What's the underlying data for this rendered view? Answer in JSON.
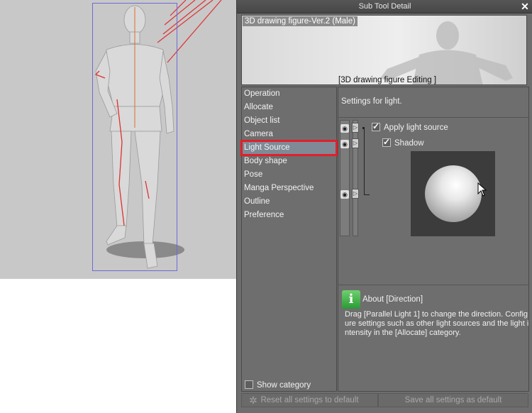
{
  "dialog": {
    "title": "Sub Tool Detail",
    "close_icon": "close-icon",
    "preview_title": "3D drawing figure-Ver.2 (Male)",
    "preview_caption": "[3D drawing figure Editing ]"
  },
  "categories": [
    {
      "label": "Operation",
      "selected": false
    },
    {
      "label": "Allocate",
      "selected": false
    },
    {
      "label": "Object list",
      "selected": false
    },
    {
      "label": "Camera",
      "selected": false
    },
    {
      "label": "Light Source",
      "selected": true
    },
    {
      "label": "Body shape",
      "selected": false
    },
    {
      "label": "Pose",
      "selected": false
    },
    {
      "label": "Manga Perspective",
      "selected": false
    },
    {
      "label": "Outline",
      "selected": false
    },
    {
      "label": "Preference",
      "selected": false
    }
  ],
  "show_category": {
    "label": "Show category",
    "checked": false
  },
  "settings": {
    "header": "Settings for light.",
    "apply_light_source": {
      "label": "Apply light source",
      "checked": true
    },
    "shadow": {
      "label": "Shadow",
      "checked": true
    }
  },
  "about": {
    "icon": "info-icon",
    "title": "About [Direction]",
    "text": "Drag [Parallel Light 1] to change the direction. Configure settings such as other light sources and the light intensity in the [Allocate] category."
  },
  "footer": {
    "reset_label": "Reset all settings to default",
    "save_label": "Save all settings as default"
  },
  "colors": {
    "selection_outline": "#e0202a",
    "dialog_bg": "#6e6e6e",
    "canvas_bg": "#c8c8c8"
  }
}
